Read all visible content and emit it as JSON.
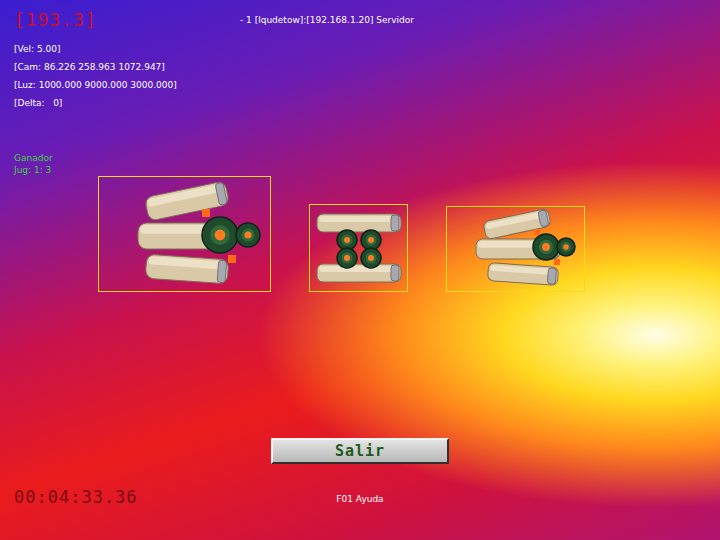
{
  "hud": {
    "score": "[193.3]",
    "stats": [
      "[Vel: 5.00]",
      "[Cam: 86.226 258.963 1072.947]",
      "[Luz: 1000.000 9000.000 3000.000]",
      "[Delta:   0]"
    ]
  },
  "players": [
    {
      "text": "- 1 [lqudetow]:[192.168.1.20] Servidor"
    }
  ],
  "result": {
    "title": "Ganador",
    "score": "Jug: 1: 3"
  },
  "ships": [
    {
      "kind": "angled",
      "selected": true
    },
    {
      "kind": "front",
      "selected": true
    },
    {
      "kind": "side",
      "selected": true
    }
  ],
  "button": "Salir",
  "clock": "00:04:33.36",
  "help": "F01 Ayuda"
}
